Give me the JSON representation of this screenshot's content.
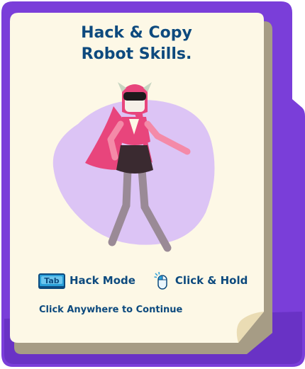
{
  "card": {
    "title_line1": "Hack & Copy",
    "title_line2": "Robot Skills."
  },
  "controls": {
    "hack_key_label": "Tab",
    "hack_label": "Hack Mode",
    "click_label": "Click & Hold"
  },
  "footer": {
    "continue_label": "Click Anywhere to Continue"
  },
  "colors": {
    "frame_purple": "#7a3ed9",
    "paper": "#fdf8e6",
    "title_blue": "#0d4a7e",
    "blob_lavender": "#dcc4f5",
    "robot_pink": "#e8457c"
  }
}
